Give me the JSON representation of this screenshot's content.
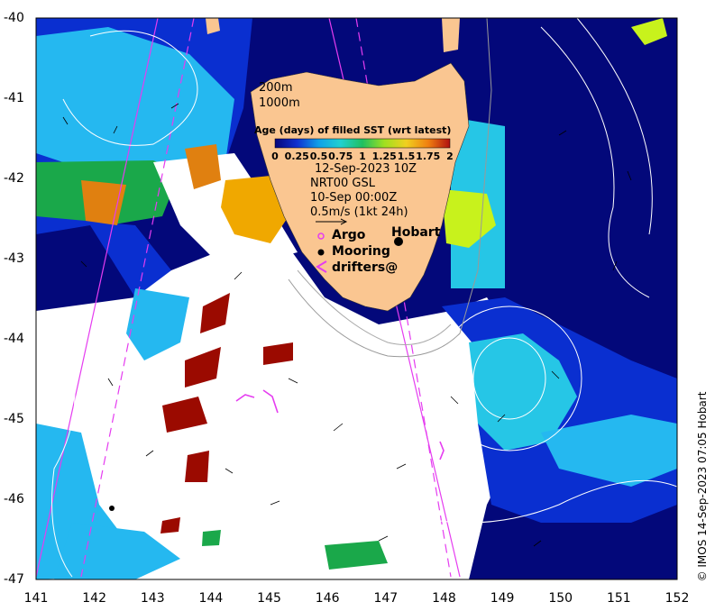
{
  "map": {
    "x_ticks": [
      "141",
      "142",
      "143",
      "144",
      "145",
      "146",
      "147",
      "148",
      "149",
      "150",
      "151",
      "152"
    ],
    "y_ticks": [
      "-40",
      "-41",
      "-42",
      "-43",
      "-44",
      "-45",
      "-46",
      "-47"
    ],
    "x_range": [
      141,
      152
    ],
    "y_range": [
      -47,
      -40
    ],
    "colors": {
      "ocean_deep": "#03087a",
      "ocean_blue": "#0a2fd0",
      "light_blue": "#25b8f0",
      "cyan": "#26c6e6",
      "green": "#1aa84a",
      "yellow_green": "#c8f21c",
      "orange": "#f0a800",
      "dark_red": "#9b0a00",
      "land": "#fac691",
      "track": "#e53cf0",
      "contour": "#ffffff"
    }
  },
  "depth_labels": [
    "200m",
    "1000m"
  ],
  "colorbar": {
    "title": "Age (days) of filled SST (wrt latest)",
    "ticks": [
      "0",
      "0.25",
      "0.5",
      "0.75",
      "1",
      "1.25",
      "1.5",
      "1.75",
      "2"
    ],
    "colors": [
      "#06067a",
      "#1030d0",
      "#10a0e8",
      "#20d0d0",
      "#20c060",
      "#a0e020",
      "#f0d020",
      "#f08010",
      "#b01010"
    ]
  },
  "info": {
    "date": "12-Sep-2023 10Z",
    "product": "NRT00 GSL",
    "time": "10-Sep 00:00Z",
    "scale": "0.5m/s (1kt 24h)"
  },
  "legend": {
    "argo": "Argo",
    "mooring": "Mooring",
    "drifters": "drifters@",
    "city": "Hobart"
  },
  "credit": "© IMOS 14-Sep-2023 07:05 Hobart"
}
